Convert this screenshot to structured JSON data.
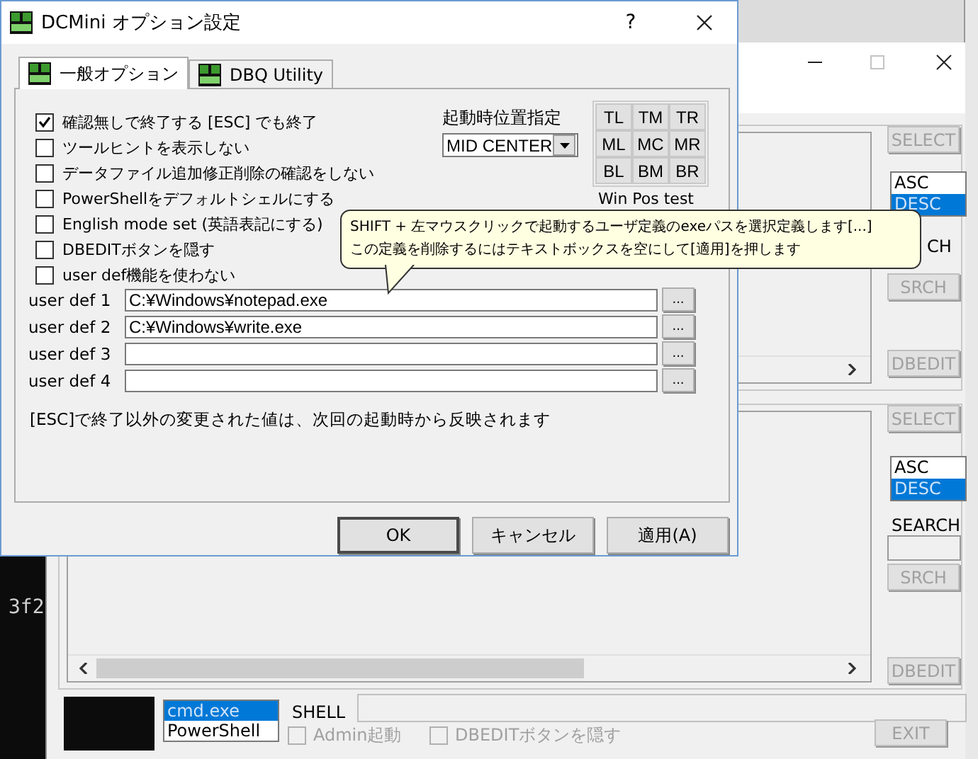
{
  "desktop": {
    "terminal_text": "3f2"
  },
  "main_window": {
    "upper_panel": {
      "select_button": {
        "label": "SELECT",
        "disabled": true
      },
      "sort_list": [
        {
          "label": "ASC",
          "selected": false
        },
        {
          "label": "DESC",
          "selected": true
        }
      ],
      "search_label": "CH",
      "srch_button": {
        "label": "SRCH",
        "disabled": true
      },
      "dbedit_button": {
        "label": "DBEDIT",
        "disabled": true
      }
    },
    "lower_panel": {
      "select_button": {
        "label": "SELECT",
        "disabled": true
      },
      "sort_list": [
        {
          "label": "ASC",
          "selected": false
        },
        {
          "label": "DESC",
          "selected": true
        }
      ],
      "search_label": "SEARCH",
      "srch_button": {
        "label": "SRCH",
        "disabled": true
      },
      "dbedit_button": {
        "label": "DBEDIT",
        "disabled": true
      }
    },
    "shell_list": [
      {
        "label": "cmd.exe",
        "selected": true
      },
      {
        "label": "PowerShell",
        "selected": false
      }
    ],
    "shell_label": "SHELL",
    "options": [
      {
        "label": "Admin起動",
        "checked": false,
        "disabled": true
      },
      {
        "label": "DBEDITボタンを隠す",
        "checked": false,
        "disabled": true
      }
    ],
    "exit_button": {
      "label": "EXIT",
      "disabled": true
    }
  },
  "dialog": {
    "title": "DCMini オプション設定",
    "help": "?",
    "tabs": [
      {
        "label": "一般オプション",
        "selected": true
      },
      {
        "label": "DBQ Utility",
        "selected": false
      }
    ],
    "checkboxes": [
      {
        "label": "確認無しで終了する [ESC] でも終了",
        "checked": true
      },
      {
        "label": "ツールヒントを表示しない",
        "checked": false
      },
      {
        "label": "データファイル追加修正削除の確認をしない",
        "checked": false
      },
      {
        "label": "PowerShellをデフォルトシェルにする",
        "checked": false
      },
      {
        "label": "English mode set (英語表記にする)",
        "checked": false
      },
      {
        "label": "DBEDITボタンを隠す",
        "checked": false
      },
      {
        "label": "user def機能を使わない",
        "checked": false
      }
    ],
    "position": {
      "label": "起動時位置指定",
      "dropdown": "MID CENTER",
      "grid": [
        "TL",
        "TM",
        "TR",
        "ML",
        "MC",
        "MR",
        "BL",
        "BM",
        "BR"
      ],
      "test_label": "Win Pos test"
    },
    "user_defs": [
      {
        "label": "user def 1",
        "value": "C:¥Windows¥notepad.exe",
        "browse": "..."
      },
      {
        "label": "user def 2",
        "value": "C:¥Windows¥write.exe",
        "browse": "..."
      },
      {
        "label": "user def 3",
        "browse": "..."
      },
      {
        "label": "user def 4",
        "browse": "..."
      }
    ],
    "note": "[ESC]で終了以外の変更された値は、次回の起動時から反映されます",
    "buttons": [
      "OK",
      "キャンセル",
      "適用(A)"
    ],
    "tooltip": [
      "SHIFT + 左マウスクリックで起動するユーザ定義のexeパスを選択定義します[...]",
      "この定義を削除するにはテキストボックスを空にして[適用]を押します"
    ]
  }
}
